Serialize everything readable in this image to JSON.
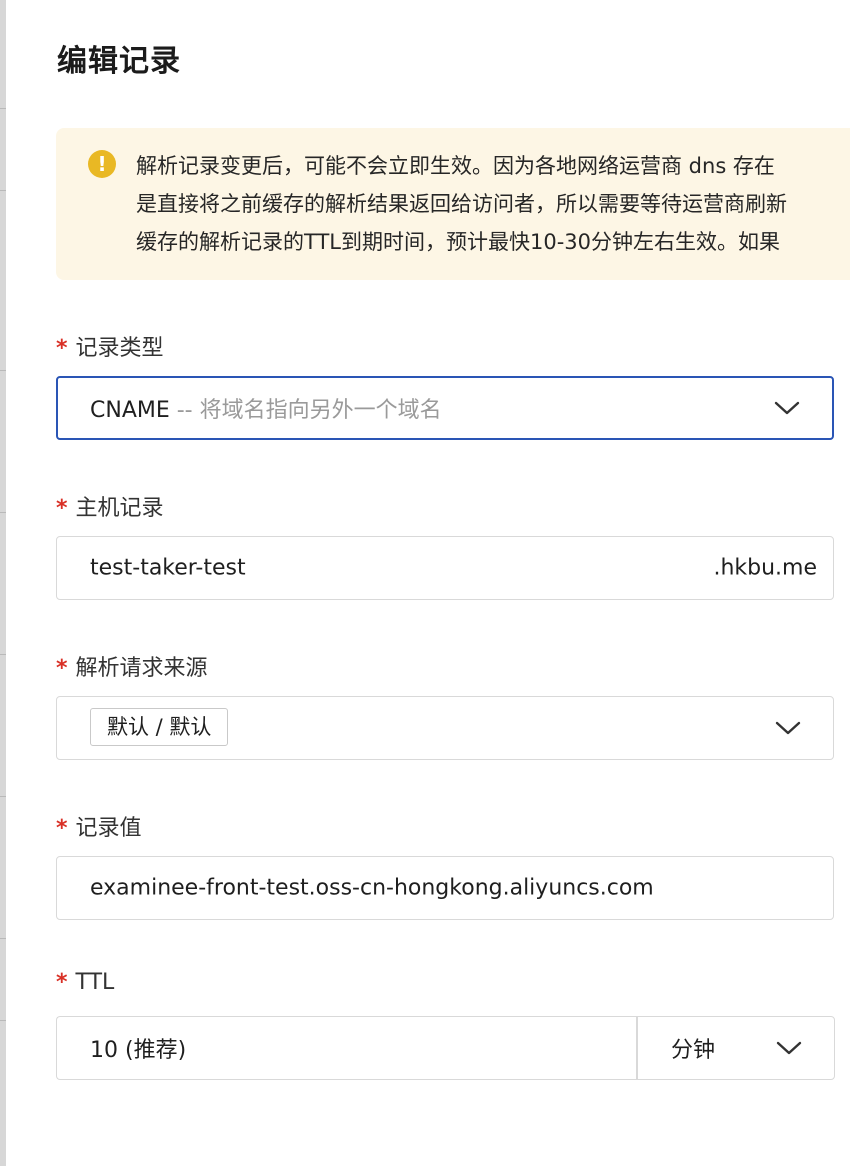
{
  "dialog": {
    "title": "编辑记录"
  },
  "notice": {
    "icon": "warning-icon",
    "accent": "#e9b824",
    "lines": [
      "解析记录变更后，可能不会立即生效。因为各地网络运营商 dns 存在",
      "是直接将之前缓存的解析结果返回给访问者，所以需要等待运营商刷新",
      "缓存的解析记录的TTL到期时间，预计最快10-30分钟左右生效。如果"
    ]
  },
  "form": {
    "required_mark": "*",
    "record_type": {
      "label": "记录类型",
      "value": "CNAME",
      "hint": " -- 将域名指向另外一个域名"
    },
    "host_record": {
      "label": "主机记录",
      "value": "test-taker-test",
      "suffix": ".hkbu.me"
    },
    "resolution_source": {
      "label": "解析请求来源",
      "tag": "默认 / 默认"
    },
    "record_value": {
      "label": "记录值",
      "value": "examinee-front-test.oss-cn-hongkong.aliyuncs.com"
    },
    "ttl": {
      "label": "TTL",
      "value": "10 (推荐)",
      "unit": "分钟"
    }
  },
  "colors": {
    "focus_border": "#2a55b5",
    "required": "#d93026",
    "notice_bg": "#fdf6e5"
  }
}
